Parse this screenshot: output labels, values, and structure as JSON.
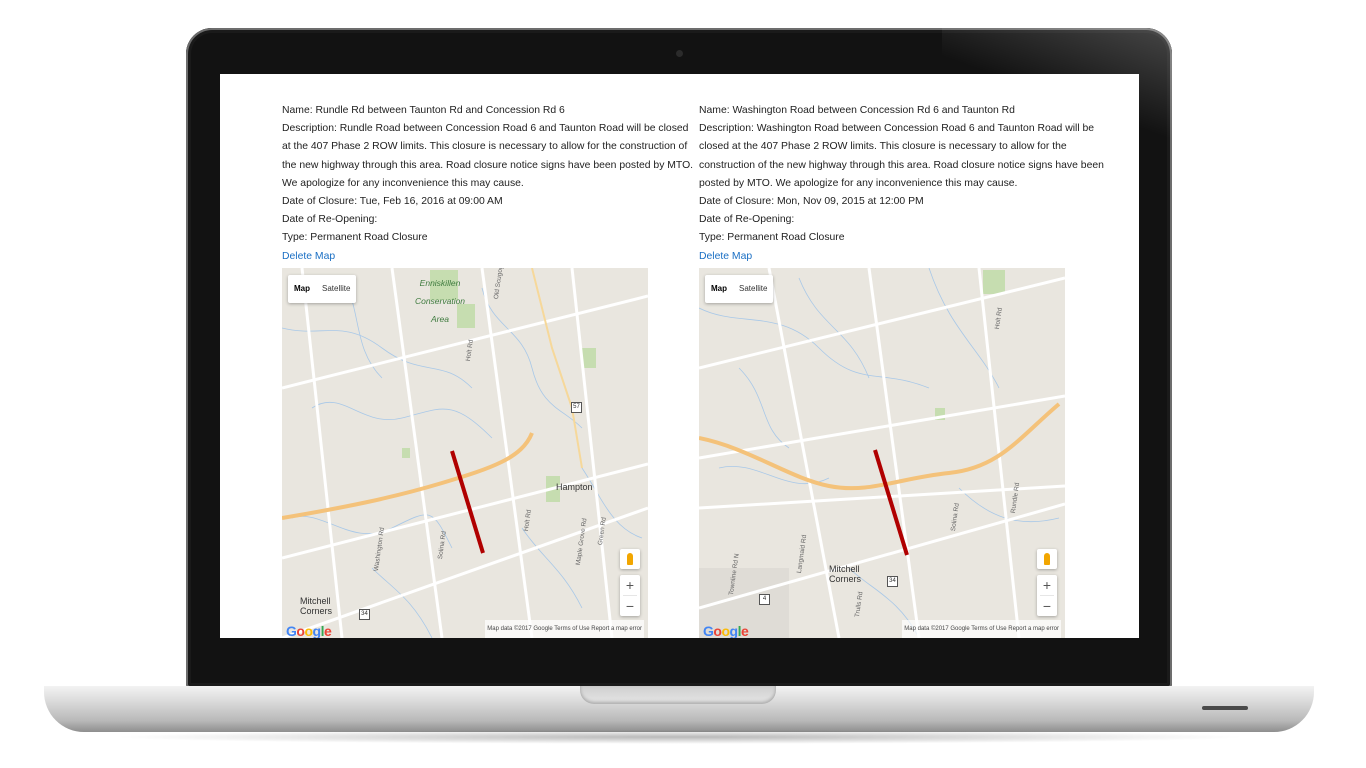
{
  "closures": [
    {
      "name": "Name: Rundle Rd between Taunton Rd and Concession Rd 6",
      "description": "Description: Rundle Road between Concession Road 6 and Taunton Road will be closed at the 407 Phase 2 ROW limits. This closure is necessary to allow for the construction of the new highway through this area. Road closure notice signs have been posted by MTO. We apologize for any inconvenience this may cause.",
      "date_closure": "Date of Closure: Tue, Feb 16, 2016 at 09:00 AM",
      "date_reopening": "Date of Re-Opening:",
      "type": "Type: Permanent Road Closure",
      "delete_label": "Delete Map",
      "map": {
        "map_tab": "Map",
        "satellite_tab": "Satellite",
        "zoom_in": "+",
        "zoom_out": "−",
        "park_label": "Enniskillen Conservation Area",
        "town_1": "Hampton",
        "town_2": "Mitchell Corners",
        "shield_1": "57",
        "shield_2": "34",
        "road_1": "Old Scugog Rd",
        "road_2": "Holt Rd",
        "road_3": "Solina Rd",
        "road_4": "Rundle Rd",
        "road_5": "Maple Grove Rd",
        "road_6": "Green Rd",
        "road_7": "Washington Rd",
        "attribution": "Map data ©2017 Google   Terms of Use   Report a map error",
        "logo": "Google"
      }
    },
    {
      "name": "Name: Washington Road between Concession Rd 6 and Taunton Rd",
      "description": "Description: Washington Road between Concession Road 6 and Taunton Road will be closed at the 407 Phase 2 ROW limits. This closure is necessary to allow for the construction of the new highway through this area. Road closure notice signs have been posted by MTO. We apologize for any inconvenience this may cause.",
      "date_closure": "Date of Closure: Mon, Nov 09, 2015 at 12:00 PM",
      "date_reopening": "Date of Re-Opening:",
      "type": "Type: Permanent Road Closure",
      "delete_label": "Delete Map",
      "map": {
        "map_tab": "Map",
        "satellite_tab": "Satellite",
        "zoom_in": "+",
        "zoom_out": "−",
        "town_1": "Mitchell Corners",
        "shield_1": "34",
        "shield_2": "4",
        "road_1": "Holt Rd",
        "road_2": "Solina Rd",
        "road_3": "Rundle Rd",
        "road_4": "Langmaid Rd",
        "road_5": "Trulls Rd",
        "road_6": "Townline Rd N",
        "attribution": "Map data ©2017 Google   Terms of Use   Report a map error",
        "logo": "Google"
      }
    }
  ],
  "colors": {
    "link": "#1a6fc4",
    "closure_line": "#b00000",
    "highway": "#f4c27a",
    "map_bg": "#e9e6df"
  }
}
